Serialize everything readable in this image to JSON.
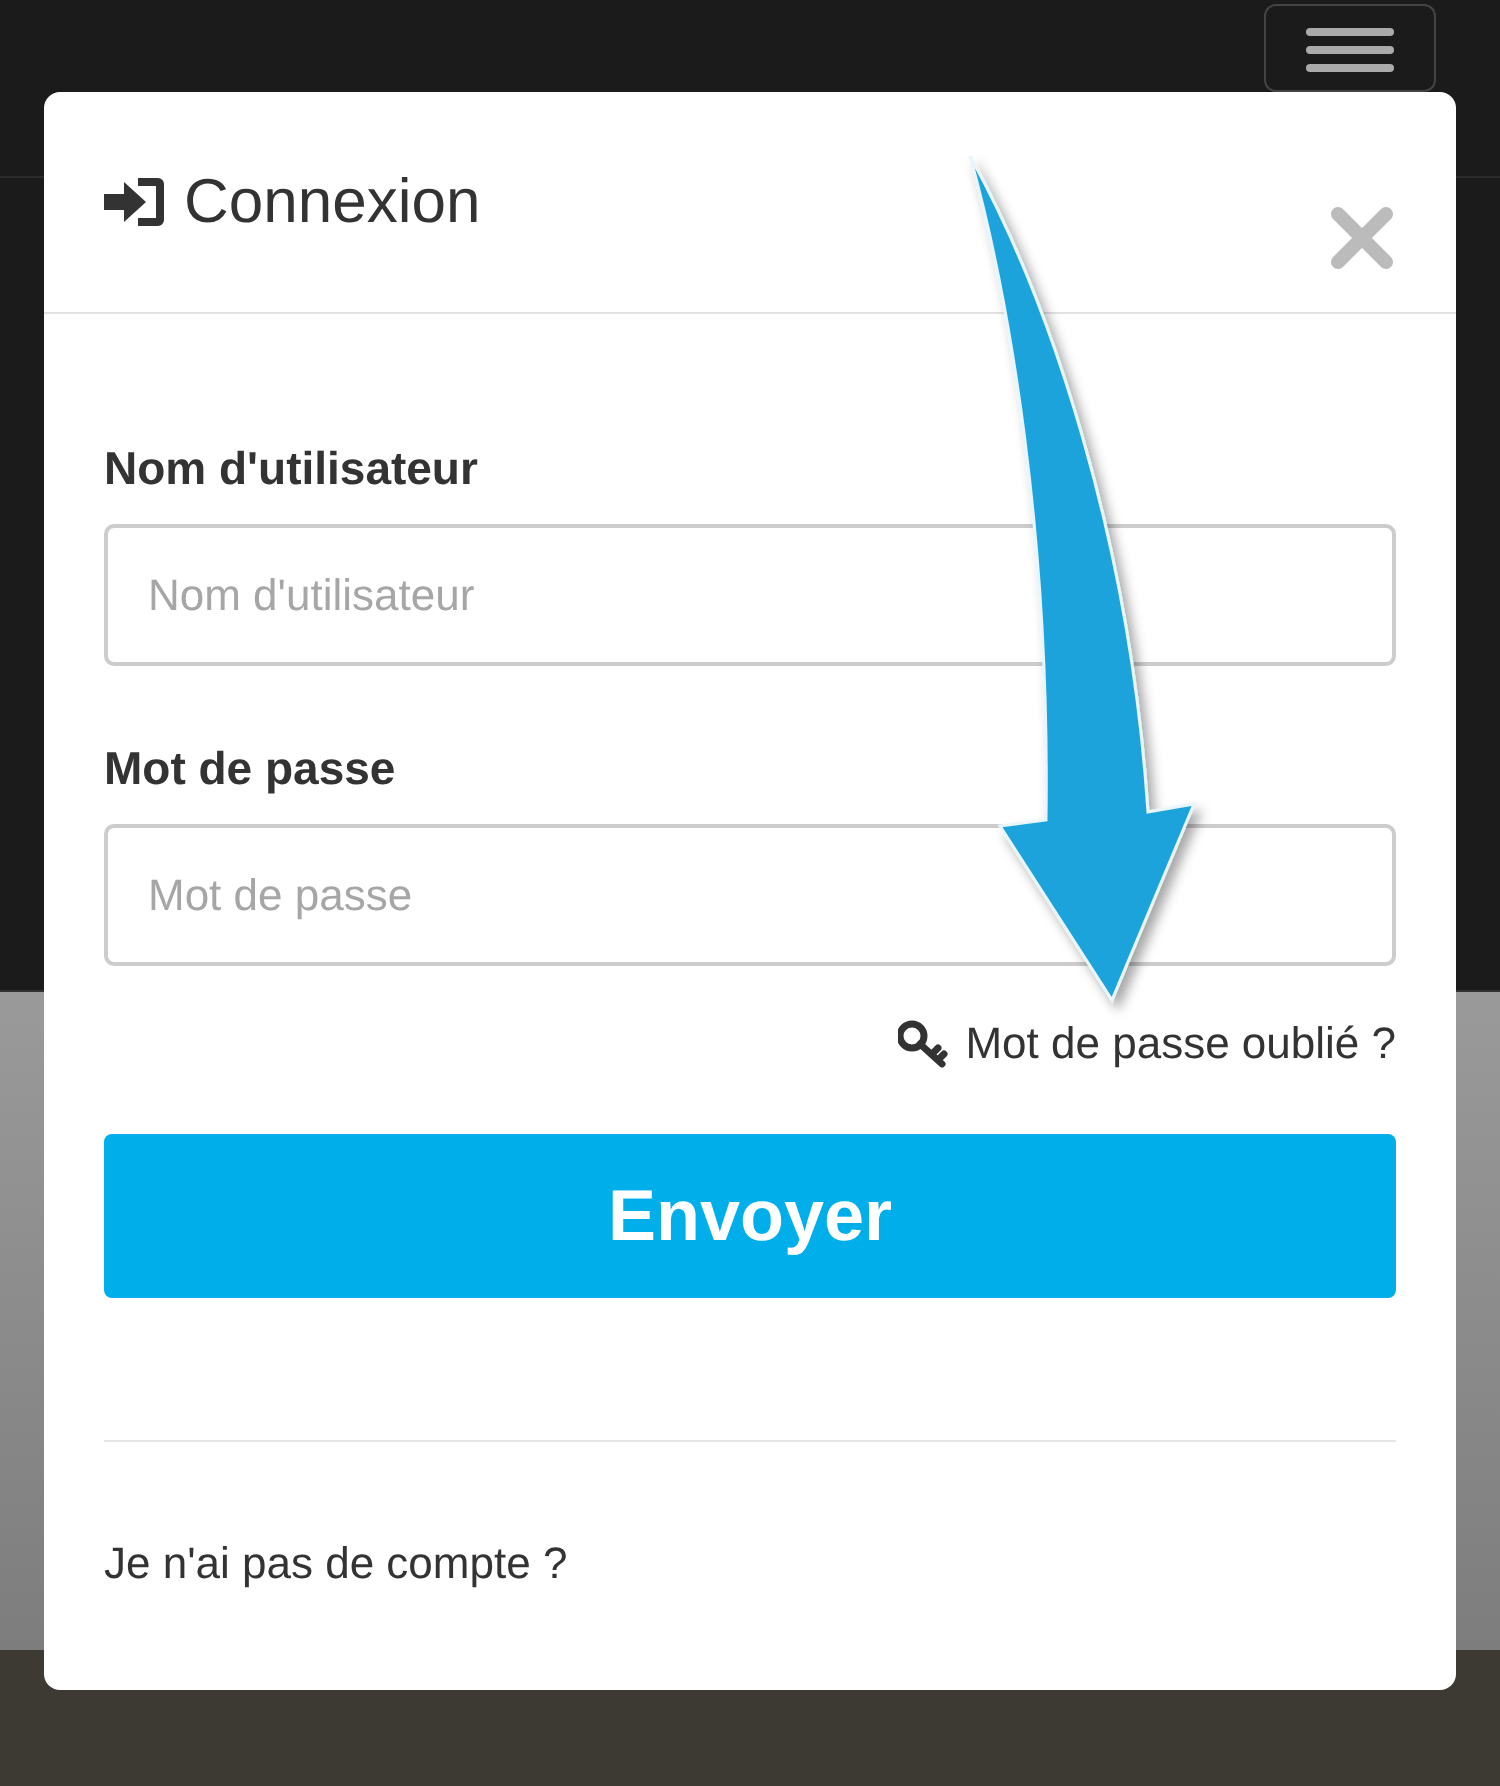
{
  "modal": {
    "title": "Connexion",
    "fields": [
      {
        "label": "Nom d'utilisateur",
        "placeholder": "Nom d'utilisateur"
      },
      {
        "label": "Mot de passe",
        "placeholder": "Mot de passe"
      }
    ],
    "forgot_link": "Mot de passe oublié ?",
    "submit": "Envoyer",
    "signup_link": "Je n'ai pas de compte ?"
  }
}
